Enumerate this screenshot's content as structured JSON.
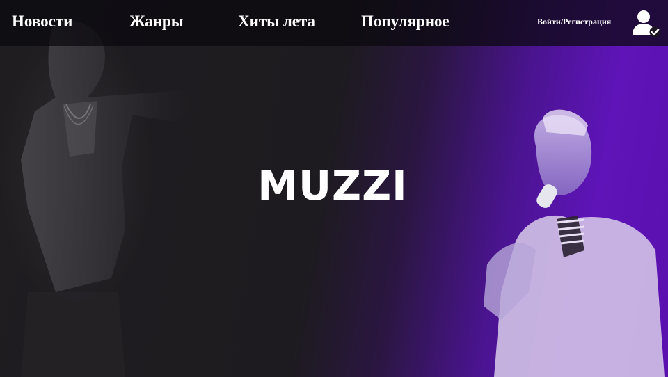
{
  "nav": {
    "items": [
      {
        "label": "Новости"
      },
      {
        "label": "Жанры"
      },
      {
        "label": "Хиты лета"
      },
      {
        "label": "Популярное"
      }
    ],
    "login_label": "Войти/Регистрация",
    "user_icon": "user-check-icon"
  },
  "hero": {
    "title": "MUZZI",
    "left_image": "artist-photo-monochrome",
    "right_image": "artist-photo-purple-tint"
  },
  "colors": {
    "background_dark": "#1d1b1f",
    "accent_purple": "#5e14b8",
    "text": "#ffffff"
  }
}
